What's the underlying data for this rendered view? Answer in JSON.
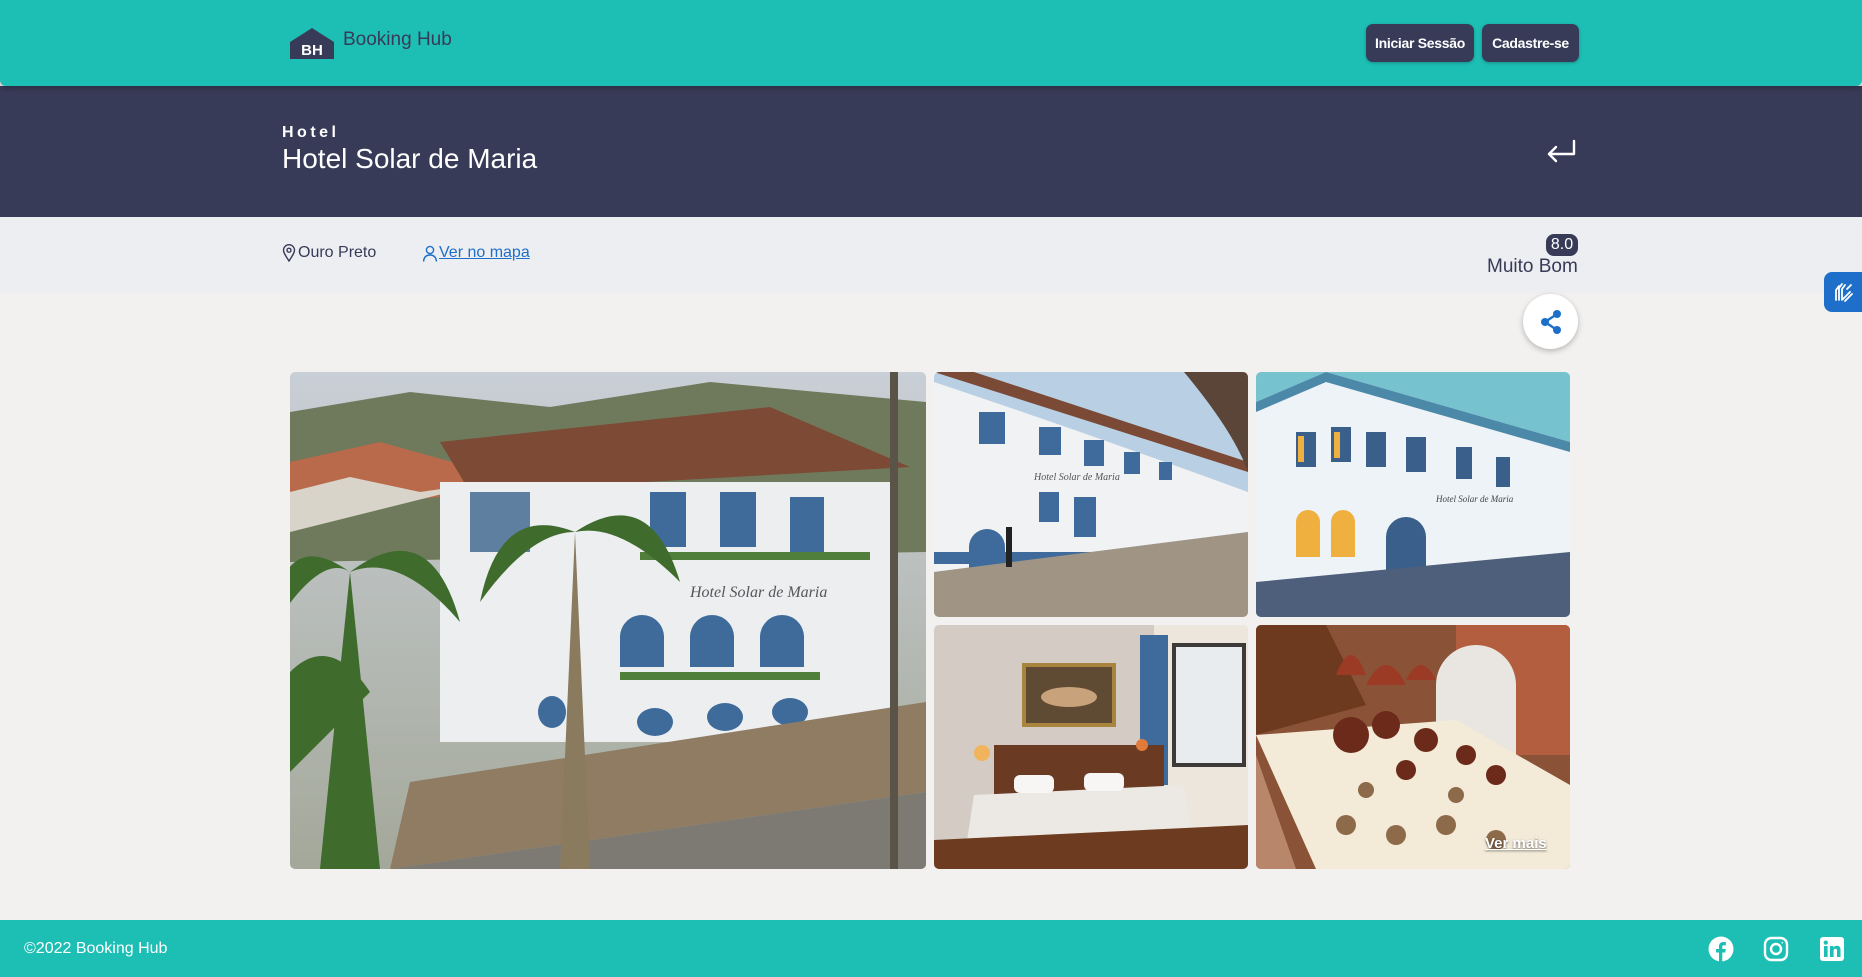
{
  "header": {
    "logo_text": "BH",
    "brand": "Booking Hub",
    "login_label": "Iniciar Sessão",
    "signup_label": "Cadastre-se"
  },
  "hotel": {
    "category": "Hotel",
    "name": "Hotel Solar de Maria"
  },
  "info": {
    "location": "Ouro Preto",
    "map_link": "Ver no mapa",
    "score": "8.0",
    "score_label": "Muito Bom"
  },
  "gallery": {
    "more_label": "Ver mais",
    "photos": [
      "hotel-facade-photo",
      "street-facade-photo",
      "facade-night-photo",
      "bedroom-photo",
      "breakfast-photo"
    ]
  },
  "footer": {
    "copyright": "©2022 Booking Hub",
    "social": [
      "facebook-icon",
      "instagram-icon",
      "linkedin-icon"
    ]
  },
  "colors": {
    "primary": "#1dbeb4",
    "dark": "#383b58",
    "link": "#1d6fc9",
    "page_bg": "#f3f1ef",
    "info_bg": "#edeef1"
  }
}
